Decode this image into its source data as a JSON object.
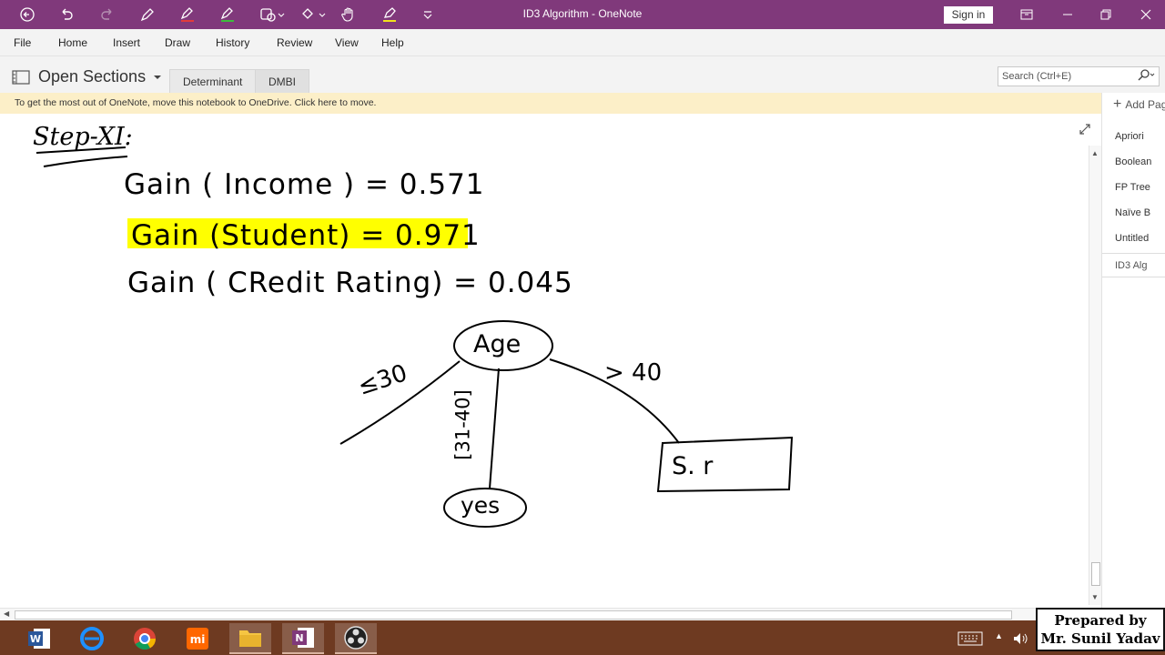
{
  "window": {
    "title": "ID3 Algorithm  -  OneNote",
    "sign_in_label": "Sign in"
  },
  "colors": {
    "titlebar": "#80397b",
    "highlight": "#ffff00",
    "banner": "#fcefc8",
    "taskbar": "#6e3a21"
  },
  "toolbar_icons": [
    "back-icon",
    "undo-icon",
    "redo-icon",
    "pen-icon",
    "red-pen-icon",
    "green-pen-icon",
    "shapes-icon",
    "lasso-icon",
    "hand-icon",
    "highlighter-icon",
    "more-icon"
  ],
  "menu": [
    "File",
    "Home",
    "Insert",
    "Draw",
    "History",
    "Review",
    "View",
    "Help"
  ],
  "sections": {
    "open_sections_label": "Open Sections",
    "tabs": [
      "Determinant",
      "DMBI"
    ],
    "active_tab": "DMBI"
  },
  "search": {
    "placeholder": "Search (Ctrl+E)"
  },
  "banner": {
    "text": "To get the most out of OneNote, move this notebook to OneDrive. Click here to move."
  },
  "pages": {
    "add_label": "Add Pag",
    "items": [
      "Apriori",
      "Boolean",
      "FP Tree",
      "Naïve B",
      "Untitled",
      "ID3 Alg"
    ],
    "active": "ID3 Alg"
  },
  "ink": {
    "heading": "Step-XI:",
    "gain_income": "Gain ( Income ) = 0.571",
    "gain_student": "Gain (Student) = 0.971",
    "gain_credit": "Gain ( CRedit Rating) = 0.045",
    "root_node": "Age",
    "branch_left": "≤30",
    "branch_middle": "[31-40]",
    "branch_right": "> 40",
    "leaf_middle": "yes",
    "leaf_right": "S. r"
  },
  "taskbar_apps": [
    "word-icon",
    "edge-icon",
    "chrome-icon",
    "mi-icon",
    "file-explorer-icon",
    "onenote-icon",
    "obs-icon"
  ],
  "watermark": {
    "line1": "Prepared by",
    "line2": "Mr. Sunil Yadav"
  }
}
